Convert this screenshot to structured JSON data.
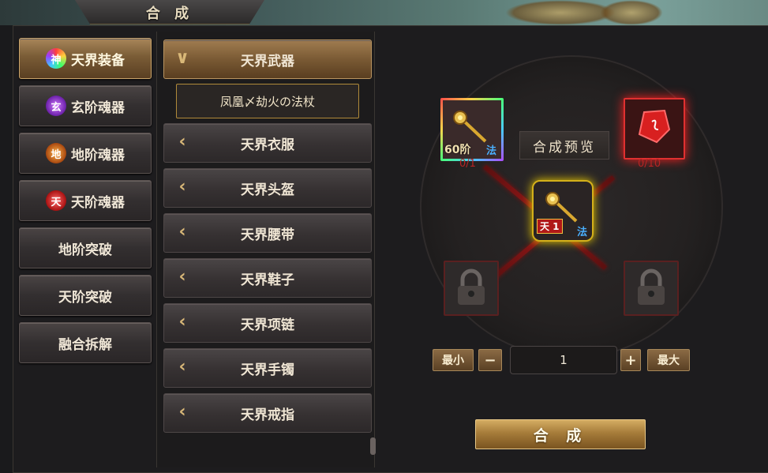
{
  "header": {
    "title": "合 成"
  },
  "left_nav": {
    "items": [
      {
        "label": "天界装备",
        "gem": "神",
        "gem_class": "rainbow",
        "active": true
      },
      {
        "label": "玄阶魂器",
        "gem": "玄",
        "gem_class": "purple"
      },
      {
        "label": "地阶魂器",
        "gem": "地",
        "gem_class": "orange"
      },
      {
        "label": "天阶魂器",
        "gem": "天",
        "gem_class": "red"
      },
      {
        "label": "地阶突破"
      },
      {
        "label": "天阶突破"
      },
      {
        "label": "融合拆解"
      }
    ]
  },
  "categories": {
    "items": [
      {
        "label": "天界武器",
        "expanded": true
      },
      {
        "label": "天界衣服"
      },
      {
        "label": "天界头盔"
      },
      {
        "label": "天界腰带"
      },
      {
        "label": "天界鞋子"
      },
      {
        "label": "天界项链"
      },
      {
        "label": "天界手镯"
      },
      {
        "label": "天界戒指"
      }
    ],
    "selected_sub": "凤凰〆劫火の法杖"
  },
  "synthesis": {
    "preview_label": "合成预览",
    "material1": {
      "level": "60阶",
      "class_tag": "法",
      "count": "0/1"
    },
    "material2": {
      "count": "0/10"
    },
    "result": {
      "badge": "天 1",
      "class_tag": "法"
    },
    "quantity": {
      "min_label": "最小",
      "minus_label": "−",
      "value": "1",
      "plus_label": "+",
      "max_label": "最大"
    },
    "compose_label": "合 成"
  }
}
